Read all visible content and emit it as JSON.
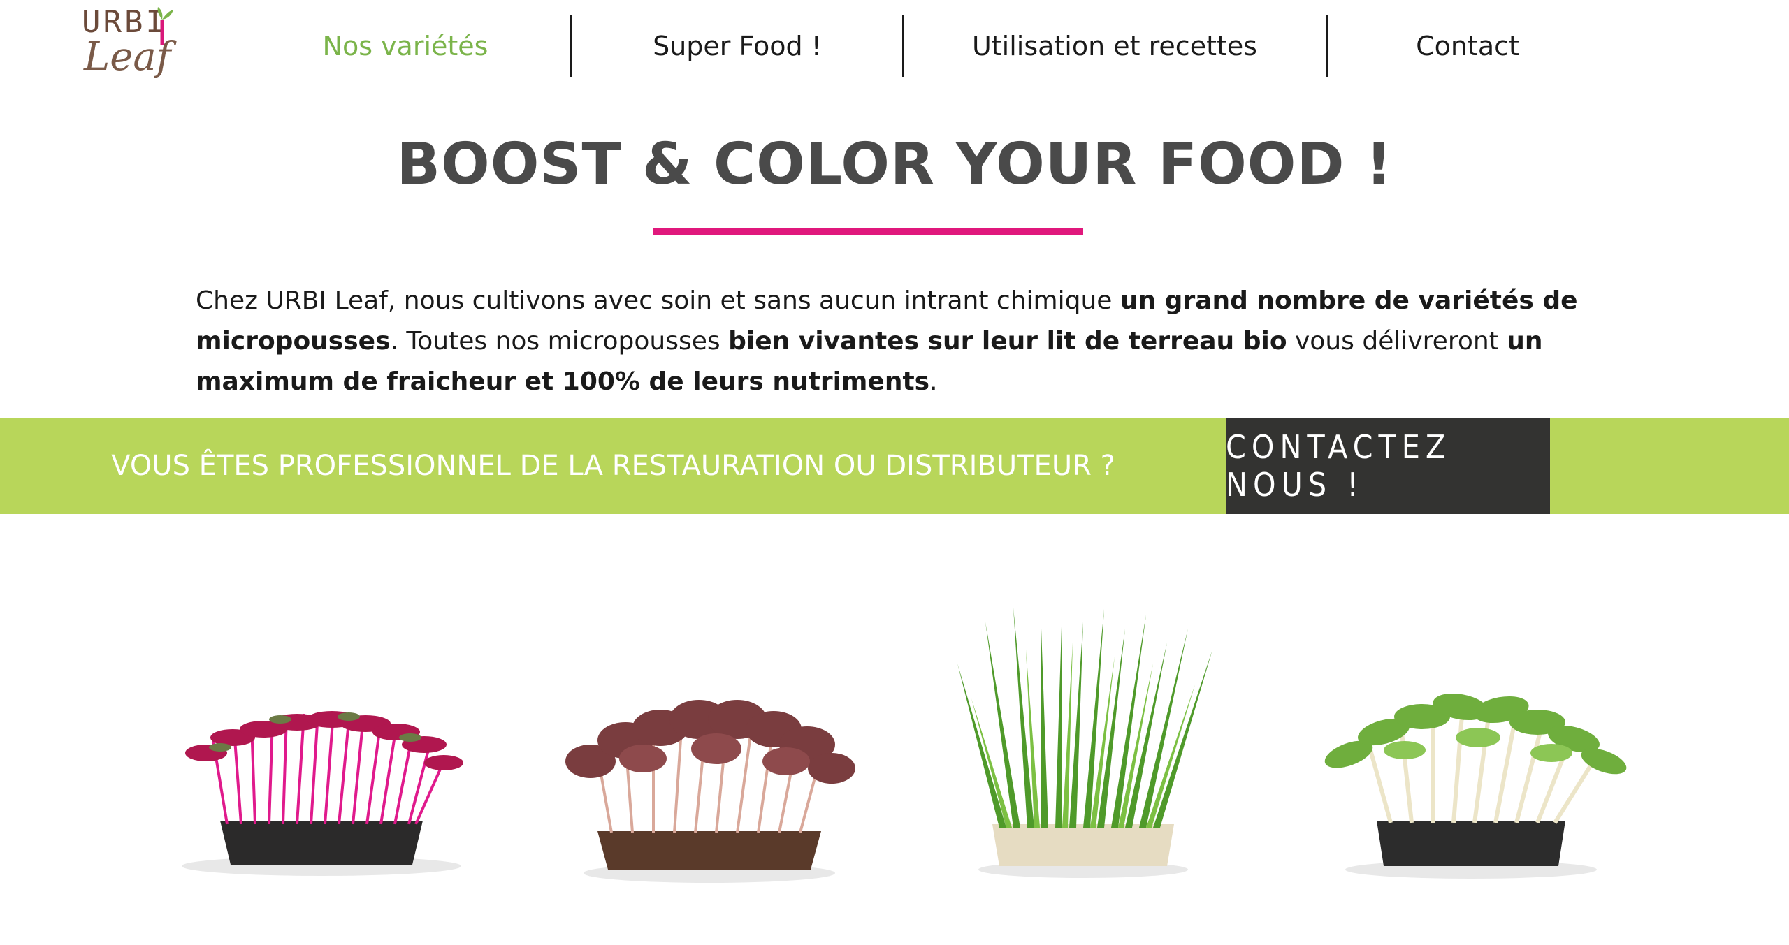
{
  "logo": {
    "line1": "URBI",
    "line2": "Leaf"
  },
  "nav": {
    "items": [
      {
        "label": "Nos variétés",
        "active": true
      },
      {
        "label": "Super Food !"
      },
      {
        "label": "Utilisation et recettes"
      },
      {
        "label": "Contact"
      }
    ]
  },
  "hero": {
    "title": "BOOST & COLOR YOUR FOOD !",
    "intro": {
      "p1": "Chez URBI Leaf, nous cultivons avec soin et sans aucun intrant chimique ",
      "b1": "un grand nombre de variétés de micropousses",
      "p2": ". Toutes nos micropousses ",
      "b2": "bien vivantes sur leur lit de terreau bio",
      "p3": " vous délivreront ",
      "b3": "un maximum de fraicheur et 100% de leurs nutriments",
      "p4": "."
    }
  },
  "banner": {
    "text": "VOUS ÊTES PROFESSIONNEL DE LA RESTAURATION OU DISTRIBUTEUR ?",
    "button": "CONTACTEZ NOUS !"
  },
  "colors": {
    "accent_green": "#b8d65a",
    "nav_active": "#7bb44a",
    "accent_pink": "#e0187c",
    "button_dark": "#333331"
  },
  "products": [
    {
      "icon": "amaranth-microgreens-image"
    },
    {
      "icon": "red-shiso-microgreens-image"
    },
    {
      "icon": "wheatgrass-microgreens-image"
    },
    {
      "icon": "sunflower-microgreens-image"
    }
  ]
}
